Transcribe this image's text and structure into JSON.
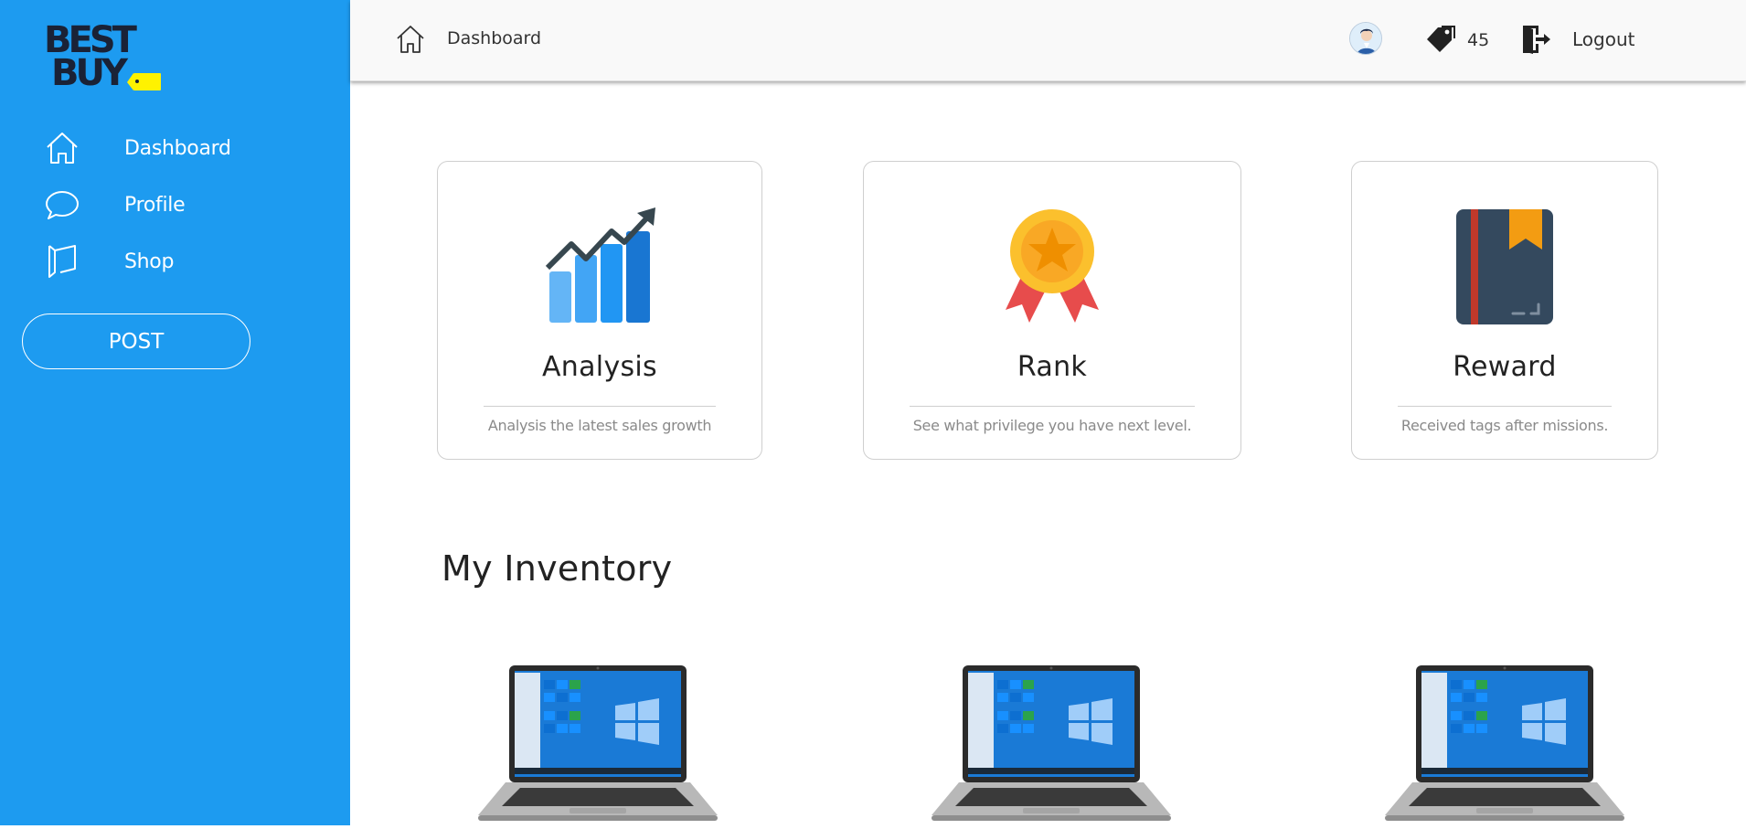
{
  "brand": {
    "logo_line1": "BEST",
    "logo_line2": "BUY"
  },
  "sidebar": {
    "items": [
      {
        "label": "Dashboard",
        "icon": "home-icon"
      },
      {
        "label": "Profile",
        "icon": "chat-bubble-icon"
      },
      {
        "label": "Shop",
        "icon": "bookmark-icon"
      }
    ],
    "post_label": "POST"
  },
  "header": {
    "breadcrumb": "Dashboard",
    "tag_count": "45",
    "logout_label": "Logout"
  },
  "cards": [
    {
      "title": "Analysis",
      "description": "Analysis the latest sales growth",
      "icon": "growth-chart-icon"
    },
    {
      "title": "Rank",
      "description": "See what privilege you have next level.",
      "icon": "medal-icon"
    },
    {
      "title": "Reward",
      "description": "Received tags after missions.",
      "icon": "book-bookmark-icon"
    }
  ],
  "inventory": {
    "title": "My Inventory",
    "items": [
      {
        "image": "laptop-image"
      },
      {
        "image": "laptop-image"
      },
      {
        "image": "laptop-image"
      }
    ]
  },
  "colors": {
    "sidebar_bg": "#1d9bf0",
    "logo_text": "#1a2236",
    "logo_tag": "#fff200"
  }
}
